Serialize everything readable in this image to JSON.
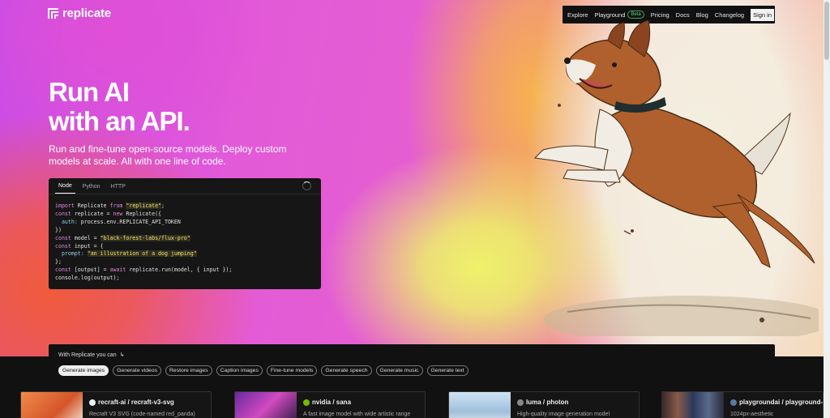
{
  "brand": {
    "name": "replicate"
  },
  "nav": {
    "items": [
      "Explore",
      "Playground",
      "Pricing",
      "Docs",
      "Blog",
      "Changelog"
    ],
    "beta_badge": "Beta",
    "signin": "Sign in"
  },
  "hero": {
    "headline_line1": "Run AI",
    "headline_line2": "with an API.",
    "subhead": "Run and fine-tune open-source models. Deploy custom models at scale. All with one line of code."
  },
  "code_card": {
    "tabs": [
      "Node",
      "Python",
      "HTTP"
    ],
    "active_tab": "Node",
    "code_tokens": {
      "line1_kw": "import",
      "line1_a": " Replicate ",
      "line1_from": "from",
      "line1_str": "\"replicate\"",
      "line1_end": ";",
      "line2_kw": "const",
      "line2_a": " replicate = ",
      "line2_new": "new",
      "line2_b": " Replicate({",
      "line3_prop": "  auth:",
      "line3_b": " process.env.REPLICATE_API_TOKEN",
      "line4": "})",
      "line5_kw": "const",
      "line5_a": " model = ",
      "line5_str": "\"black-forest-labs/flux-pro\"",
      "line6_kw": "const",
      "line6_a": " input = {",
      "line7_prop": "  prompt:",
      "line7_str": "\"an illustration of a dog jumping\"",
      "line8": "};",
      "line9_kw": "const",
      "line9_a": " [output] = ",
      "line9_await": "await",
      "line9_b": " replicate.run(model, { input });",
      "line10": "console.log(output);"
    }
  },
  "use_cases": {
    "title": "With Replicate you can",
    "chips": [
      "Generate images",
      "Generate videos",
      "Restore images",
      "Caption images",
      "Fine-tune models",
      "Generate speech",
      "Generate music",
      "Generate text"
    ],
    "active": "Generate images"
  },
  "model_cards": [
    {
      "title": "recraft-ai / recraft-v3-svg",
      "desc": "Recraft V3 SVG (code-named red_panda)"
    },
    {
      "title": "nvidia / sana",
      "desc": "A fast image model with wide artistic range"
    },
    {
      "title": "luma / photon",
      "desc": "High-quality image generation model"
    },
    {
      "title": "playgroundai / playground-v...",
      "desc": "1024px-aesthetic"
    }
  ],
  "colors": {
    "accent_green": "#3fa55a",
    "code_string": "#f3e36a",
    "code_keyword": "#d98ad6"
  }
}
